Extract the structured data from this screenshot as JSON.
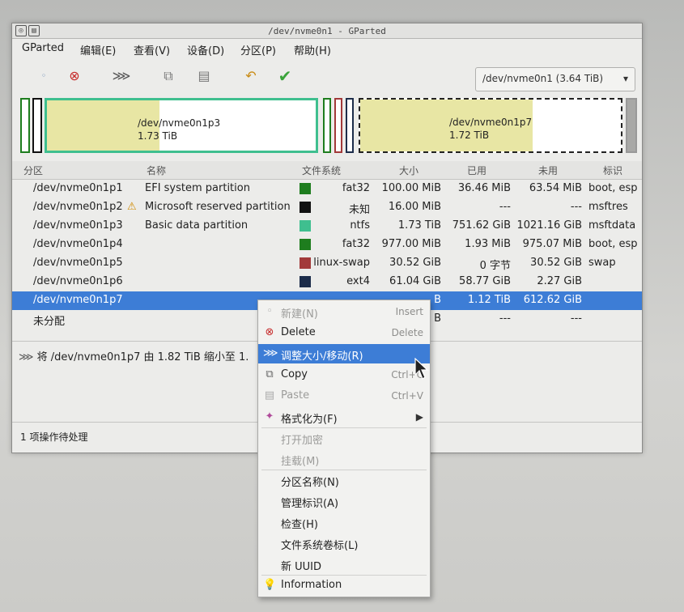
{
  "window": {
    "title": "/dev/nvme0n1 - GParted",
    "close_glyph": "⊘"
  },
  "menubar": [
    "GParted",
    "编辑(E)",
    "查看(V)",
    "设备(D)",
    "分区(P)",
    "帮助(H)"
  ],
  "toolbar": {
    "icons": [
      "new-icon",
      "delete-icon",
      "resize-move-icon",
      "copy-icon",
      "paste-icon",
      "undo-icon",
      "apply-icon"
    ],
    "device": "/dev/nvme0n1 (3.64 TiB)"
  },
  "graph": {
    "p3_name": "/dev/nvme0n1p3",
    "p3_size": "1.73 TiB",
    "p7_name": "/dev/nvme0n1p7",
    "p7_size": "1.72 TiB"
  },
  "columns": [
    "分区",
    "名称",
    "文件系统",
    "大小",
    "已用",
    "未用",
    "标识"
  ],
  "rows": [
    {
      "part": "/dev/nvme0n1p1",
      "name": "EFI system partition",
      "fs": "fat32",
      "color": "#1e7d1e",
      "size": "100.00 MiB",
      "used": "36.46 MiB",
      "unused": "63.54 MiB",
      "flags": "boot, esp"
    },
    {
      "part": "/dev/nvme0n1p2",
      "name": "Microsoft reserved partition",
      "fs": "未知",
      "color": "#111111",
      "size": "16.00 MiB",
      "used": "---",
      "unused": "---",
      "flags": "msftres",
      "warning": true
    },
    {
      "part": "/dev/nvme0n1p3",
      "name": "Basic data partition",
      "fs": "ntfs",
      "color": "#3fbf8f",
      "size": "1.73 TiB",
      "used": "751.62 GiB",
      "unused": "1021.16 GiB",
      "flags": "msftdata"
    },
    {
      "part": "/dev/nvme0n1p4",
      "name": "",
      "fs": "fat32",
      "color": "#1e7d1e",
      "size": "977.00 MiB",
      "used": "1.93 MiB",
      "unused": "975.07 MiB",
      "flags": "boot, esp"
    },
    {
      "part": "/dev/nvme0n1p5",
      "name": "",
      "fs": "linux-swap",
      "color": "#a23a3a",
      "size": "30.52 GiB",
      "used": "0 字节",
      "unused": "30.52 GiB",
      "flags": "swap"
    },
    {
      "part": "/dev/nvme0n1p6",
      "name": "",
      "fs": "ext4",
      "color": "#1c2c4a",
      "size": "61.04 GiB",
      "used": "58.77 GiB",
      "unused": "2.27 GiB",
      "flags": ""
    },
    {
      "part": "/dev/nvme0n1p7",
      "name": "",
      "fs": "",
      "color": "",
      "size": "B",
      "used": "1.12 TiB",
      "unused": "612.62 GiB",
      "flags": "",
      "selected": true
    },
    {
      "part": "未分配",
      "name": "",
      "fs": "",
      "color": "",
      "size": "B",
      "used": "---",
      "unused": "---",
      "flags": ""
    }
  ],
  "pending_op": "将 /dev/nvme0n1p7 由 1.82 TiB 缩小至 1.",
  "status": "1 项操作待处理",
  "context_menu": [
    {
      "label": "新建(N)",
      "shortcut": "Insert",
      "icon": "new-icon",
      "disabled": true
    },
    {
      "label": "Delete",
      "shortcut": "Delete",
      "icon": "delete-icon",
      "disabled": false
    },
    {
      "label": "调整大小/移动(R)",
      "shortcut": "",
      "icon": "resize-move-icon",
      "highlight": true
    },
    {
      "label": "Copy",
      "shortcut": "Ctrl+C",
      "icon": "copy-icon",
      "disabled": false
    },
    {
      "label": "Paste",
      "shortcut": "Ctrl+V",
      "icon": "paste-icon",
      "disabled": true
    },
    {
      "label": "格式化为(F)",
      "shortcut": "▶",
      "icon": "format-icon",
      "disabled": false
    },
    {
      "label": "打开加密",
      "shortcut": "",
      "icon": "",
      "disabled": true
    },
    {
      "label": "挂载(M)",
      "shortcut": "",
      "icon": "",
      "disabled": true
    },
    {
      "label": "分区名称(N)",
      "shortcut": "",
      "icon": "",
      "disabled": false
    },
    {
      "label": "管理标识(A)",
      "shortcut": "",
      "icon": "",
      "disabled": false
    },
    {
      "label": "检查(H)",
      "shortcut": "",
      "icon": "",
      "disabled": false
    },
    {
      "label": "文件系统卷标(L)",
      "shortcut": "",
      "icon": "",
      "disabled": false
    },
    {
      "label": "新 UUID",
      "shortcut": "",
      "icon": "",
      "disabled": false
    },
    {
      "label": "Information",
      "shortcut": "",
      "icon": "info-icon",
      "disabled": false
    }
  ]
}
